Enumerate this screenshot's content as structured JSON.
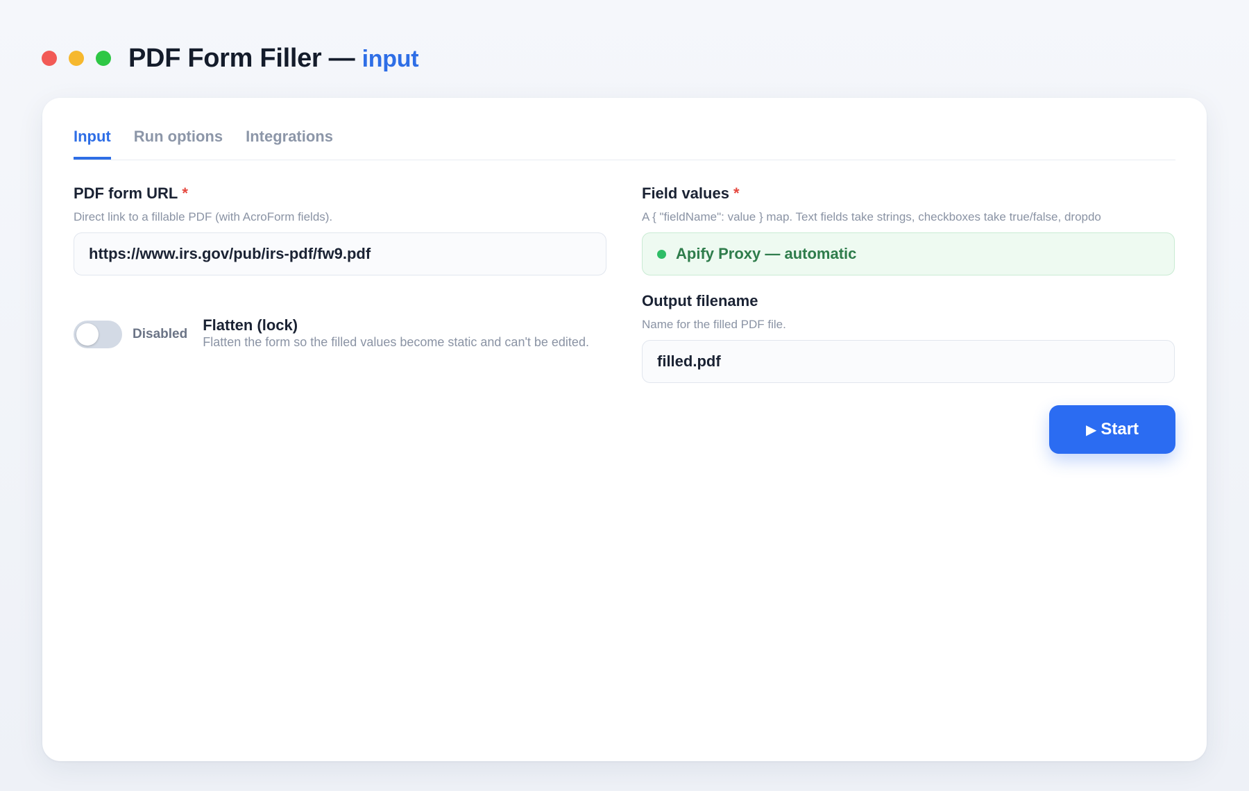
{
  "window": {
    "title": "PDF Form Filler —",
    "title_accent": "input"
  },
  "tabs": [
    {
      "label": "Input",
      "active": true
    },
    {
      "label": "Run options",
      "active": false
    },
    {
      "label": "Integrations",
      "active": false
    }
  ],
  "fields": {
    "pdf_url": {
      "label": "PDF form URL",
      "required_mark": "*",
      "help": "Direct link to a fillable PDF (with AcroForm fields).",
      "value": "https://www.irs.gov/pub/irs-pdf/fw9.pdf"
    },
    "field_values": {
      "label": "Field values",
      "required_mark": "*",
      "help": "A { \"fieldName\": value } map. Text fields take strings, checkboxes take true/false, dropdo",
      "value": "Apify Proxy — automatic",
      "status_color": "#2ebd66"
    },
    "flatten": {
      "state": "Disabled",
      "label": "Flatten (lock)",
      "help": "Flatten the form so the filled values become static and can't be edited.",
      "enabled": false
    },
    "output_filename": {
      "label": "Output filename",
      "help": "Name for the filled PDF file.",
      "value": "filled.pdf"
    }
  },
  "actions": {
    "start_icon": "▶",
    "start_label": "Start"
  },
  "colors": {
    "accent": "#2e6ee6",
    "button": "#2b6cf2",
    "required": "#e5483f",
    "success_text": "#2e7c4b",
    "traffic_red": "#f25a56",
    "traffic_yellow": "#f6b82e",
    "traffic_green": "#2ec745"
  }
}
